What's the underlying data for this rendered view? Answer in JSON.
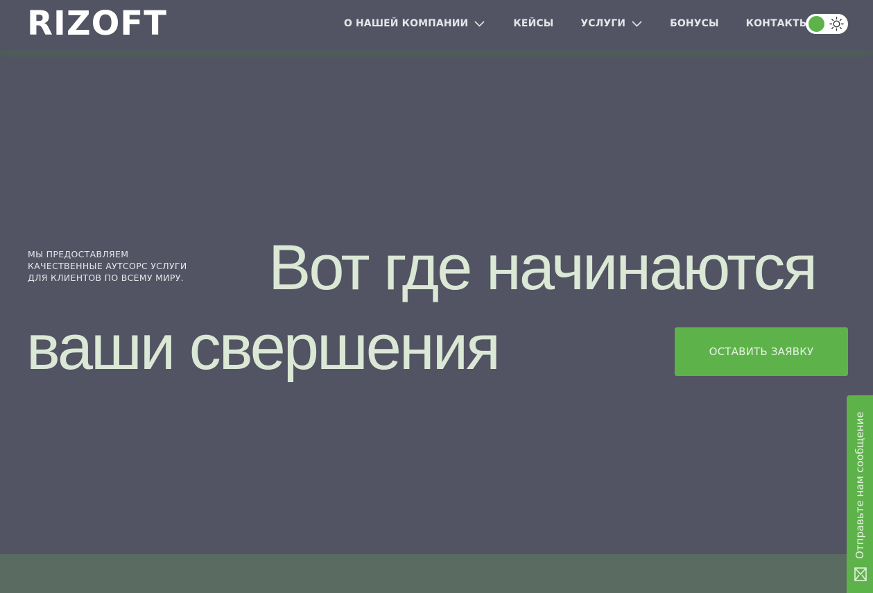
{
  "brand": {
    "logo_text": "RIZOFT",
    "accent_color": "#5db34a",
    "background_color": "#525463",
    "headline_color": "#dbe8d5"
  },
  "nav": {
    "items": [
      {
        "label": "О НАШЕЙ КОМПАНИИ",
        "has_dropdown": true
      },
      {
        "label": "КЕЙСЫ",
        "has_dropdown": false
      },
      {
        "label": "УСЛУГИ",
        "has_dropdown": true
      },
      {
        "label": "БОНУСЫ",
        "has_dropdown": false
      },
      {
        "label": "КОНТАКТЫ",
        "has_dropdown": false
      }
    ],
    "theme_toggle_icon": "sun-icon"
  },
  "hero": {
    "intro": "МЫ ПРЕДОСТАВЛЯЕМ КАЧЕСТВЕННЫЕ АУТСОРС УСЛУГИ ДЛЯ КЛИЕНТОВ ПО ВСЕМУ МИРУ.",
    "headline_line1": "Вот где начинаются",
    "headline_line2": "ваши свершения",
    "cta_label": "ОСТАВИТЬ ЗАЯВКУ"
  },
  "feedback_tab": {
    "label": "Отправьте нам сообщение",
    "icon": "mail-icon"
  }
}
